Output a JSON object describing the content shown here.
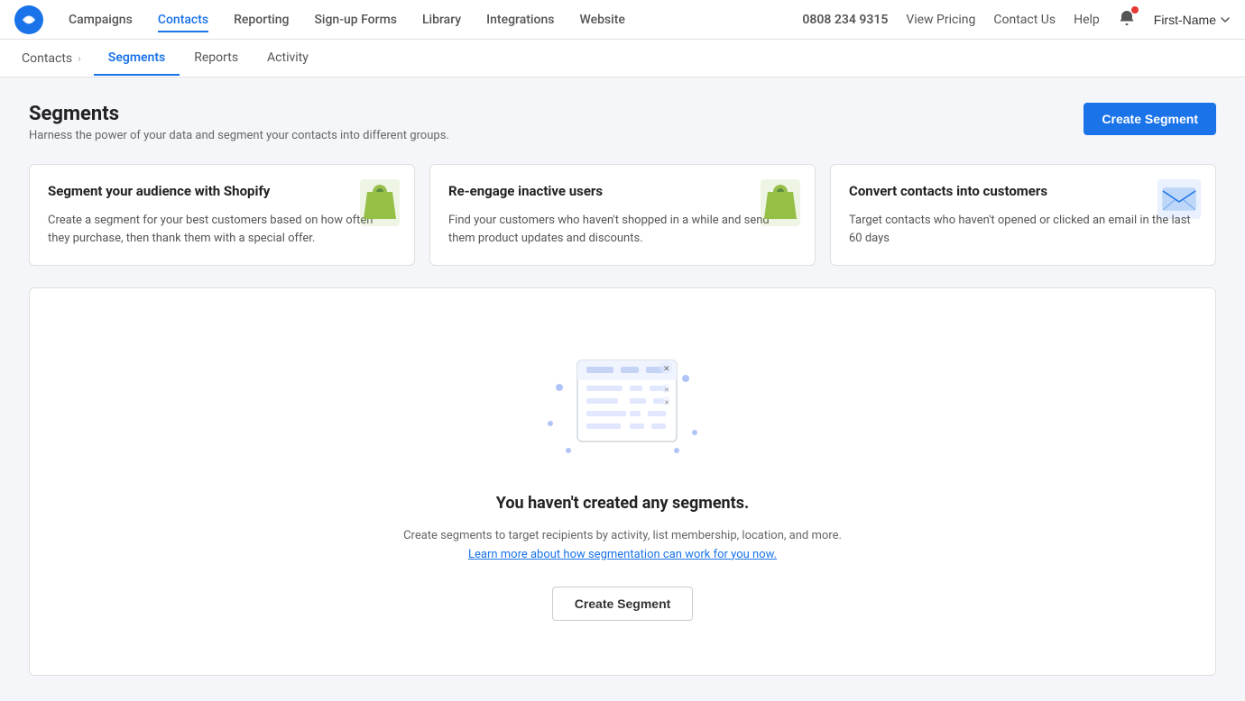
{
  "topnav": {
    "logo_alt": "Logo",
    "nav_items": [
      {
        "label": "Campaigns",
        "href": "#",
        "active": false
      },
      {
        "label": "Contacts",
        "href": "#",
        "active": true
      },
      {
        "label": "Reporting",
        "href": "#",
        "active": false
      },
      {
        "label": "Sign-up Forms",
        "href": "#",
        "active": false
      },
      {
        "label": "Library",
        "href": "#",
        "active": false
      },
      {
        "label": "Integrations",
        "href": "#",
        "active": false
      },
      {
        "label": "Website",
        "href": "#",
        "active": false
      }
    ],
    "phone": "0808 234 9315",
    "view_pricing": "View Pricing",
    "contact_us": "Contact Us",
    "help": "Help",
    "user_name": "First-Name"
  },
  "subnav": {
    "breadcrumb_contacts": "Contacts",
    "breadcrumb_sep": ">",
    "tabs": [
      {
        "label": "Segments",
        "active": true
      },
      {
        "label": "Reports",
        "active": false
      },
      {
        "label": "Activity",
        "active": false
      }
    ]
  },
  "page": {
    "title": "Segments",
    "subtitle": "Harness the power of your data and segment your contacts into different groups.",
    "create_btn": "Create Segment"
  },
  "cards": [
    {
      "title": "Segment your audience with Shopify",
      "desc": "Create a segment for your best customers based on how often they purchase, then thank them with a special offer.",
      "icon": "shopify"
    },
    {
      "title": "Re-engage inactive users",
      "desc": "Find your customers who haven't shopped in a while and send them product updates and discounts.",
      "icon": "shopify"
    },
    {
      "title": "Convert contacts into customers",
      "desc": "Target contacts who haven't opened or clicked an email in the last 60 days",
      "icon": "email"
    }
  ],
  "empty_state": {
    "title": "You haven't created any segments.",
    "desc_part1": "Create segments to target recipients by activity, list membership, location, and more.",
    "desc_link": "Learn more about how segmentation can work for you now.",
    "create_btn": "Create Segment"
  }
}
